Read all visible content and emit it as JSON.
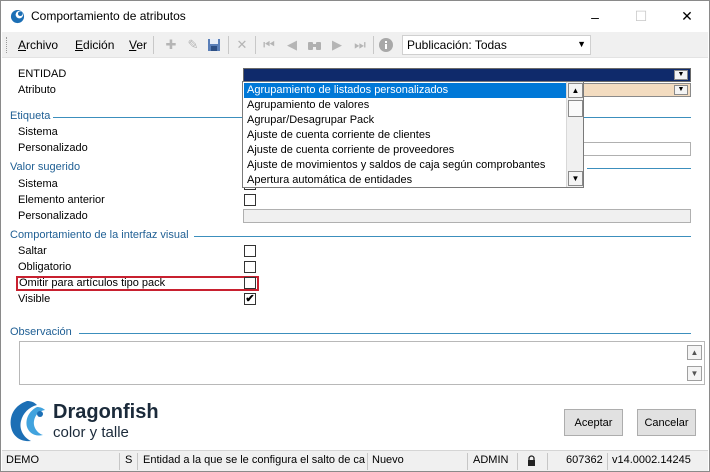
{
  "window": {
    "title": "Comportamiento de atributos",
    "controls": {
      "minimize": "–",
      "maximize": "☐",
      "close": "✕"
    }
  },
  "menu": {
    "items": [
      {
        "label": "Archivo",
        "key": "A",
        "rest": "rchivo"
      },
      {
        "label": "Edición",
        "key": "E",
        "rest": "dición"
      },
      {
        "label": "Ver",
        "key": "V",
        "rest": "er"
      }
    ]
  },
  "toolbar": {
    "icons": [
      "plus-icon",
      "pencil-icon",
      "save-icon",
      "delete-icon",
      "first-icon",
      "previous-icon",
      "search-icon",
      "next-icon",
      "last-icon",
      "info-icon"
    ],
    "publication": {
      "value": "Publicación: Todas"
    }
  },
  "form": {
    "entidad_label": "ENTIDAD",
    "atributo_label": "Atributo",
    "etiqueta_section": "Etiqueta",
    "sistema_label": "Sistema",
    "personalizado_label": "Personalizado",
    "valor_sugerido_section": "Valor sugerido",
    "sistema2_label": "Sistema",
    "elemento_anterior_label": "Elemento anterior",
    "personalizado2_label": "Personalizado",
    "comportamiento_section": "Comportamiento de la interfaz visual",
    "saltar_label": "Saltar",
    "obligatorio_label": "Obligatorio",
    "omitir_label": "Omitir para artículos tipo pack",
    "visible_label": "Visible",
    "visible_checked": "✔",
    "observacion_section": "Observación"
  },
  "dropdown": {
    "options": [
      "Agrupamiento de listados personalizados",
      "Agrupamiento de valores",
      "Agrupar/Desagrupar Pack",
      "Ajuste de cuenta corriente de clientes",
      "Ajuste de cuenta corriente de proveedores",
      "Ajuste de movimientos y saldos de caja según comprobantes",
      "Apertura automática de entidades"
    ],
    "selected_index": 0
  },
  "logo": {
    "name": "Dragonfish",
    "subtitle": "color y talle"
  },
  "buttons": {
    "accept": "Aceptar",
    "cancel": "Cancelar"
  },
  "statusbar": {
    "mode": "DEMO",
    "flag": "S",
    "message": "Entidad a la que se le configura el salto de camp",
    "state": "Nuevo",
    "user": "ADMIN",
    "lock_icon": "lock-icon",
    "number": "607362",
    "version": "v14.0002.14245"
  },
  "colors": {
    "accent": "#0078d7",
    "section_text": "#1f5f94",
    "highlight_border": "#c8202f",
    "entity_bar": "#0f2a6b",
    "atributo_bar": "#f3dcc0"
  }
}
